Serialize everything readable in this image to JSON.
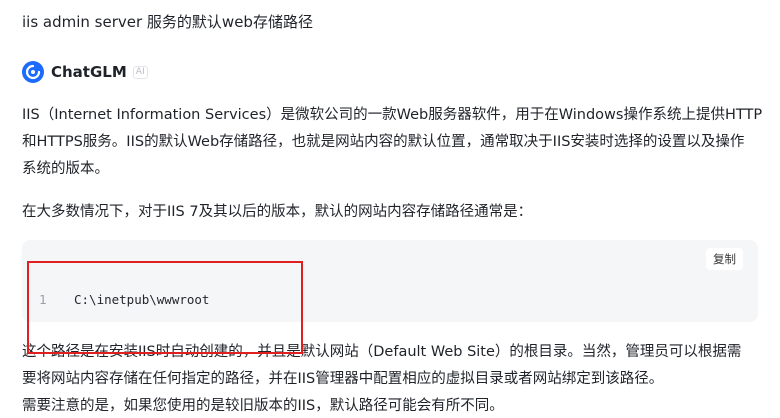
{
  "conversation": {
    "user_question": "iis admin server 服务的默认web存储路径"
  },
  "assistant": {
    "name": "ChatGLM",
    "badge": "AI",
    "icon": "chatglm-logo-icon",
    "paragraphs": [
      {
        "lines": [
          "IIS（Internet Information Services）是微软公司的一款Web服务器软件，用于在Windows操作系统上提供HTTP",
          "和HTTPS服务。IIS的默认Web存储路径，也就是网站内容的默认位置，通常取决于IIS安装时选择的设置以及操作",
          "系统的版本。"
        ]
      },
      {
        "lines": [
          "在大多数情况下，对于IIS 7及其以后的版本，默认的网站内容存储路径通常是："
        ]
      }
    ],
    "code_block": {
      "copy_label": "复制",
      "line_number": "1",
      "code": "C:\\inetpub\\wwwroot"
    },
    "after_code": {
      "lines": [
        "这个路径是在安装IIS时自动创建的，并且是默认网站（Default Web Site）的根目录。当然，管理员可以根据需",
        "要将网站内容存储在任何指定的路径，并在IIS管理器中配置相应的虚拟目录或者网站绑定到该路径。",
        "需要注意的是，如果您使用的是较旧版本的IIS，默认路径可能会有所不同。"
      ]
    }
  },
  "colors": {
    "brand": "#1c6bff",
    "highlight": "#e02020",
    "code_bg": "#f5f6f7"
  }
}
